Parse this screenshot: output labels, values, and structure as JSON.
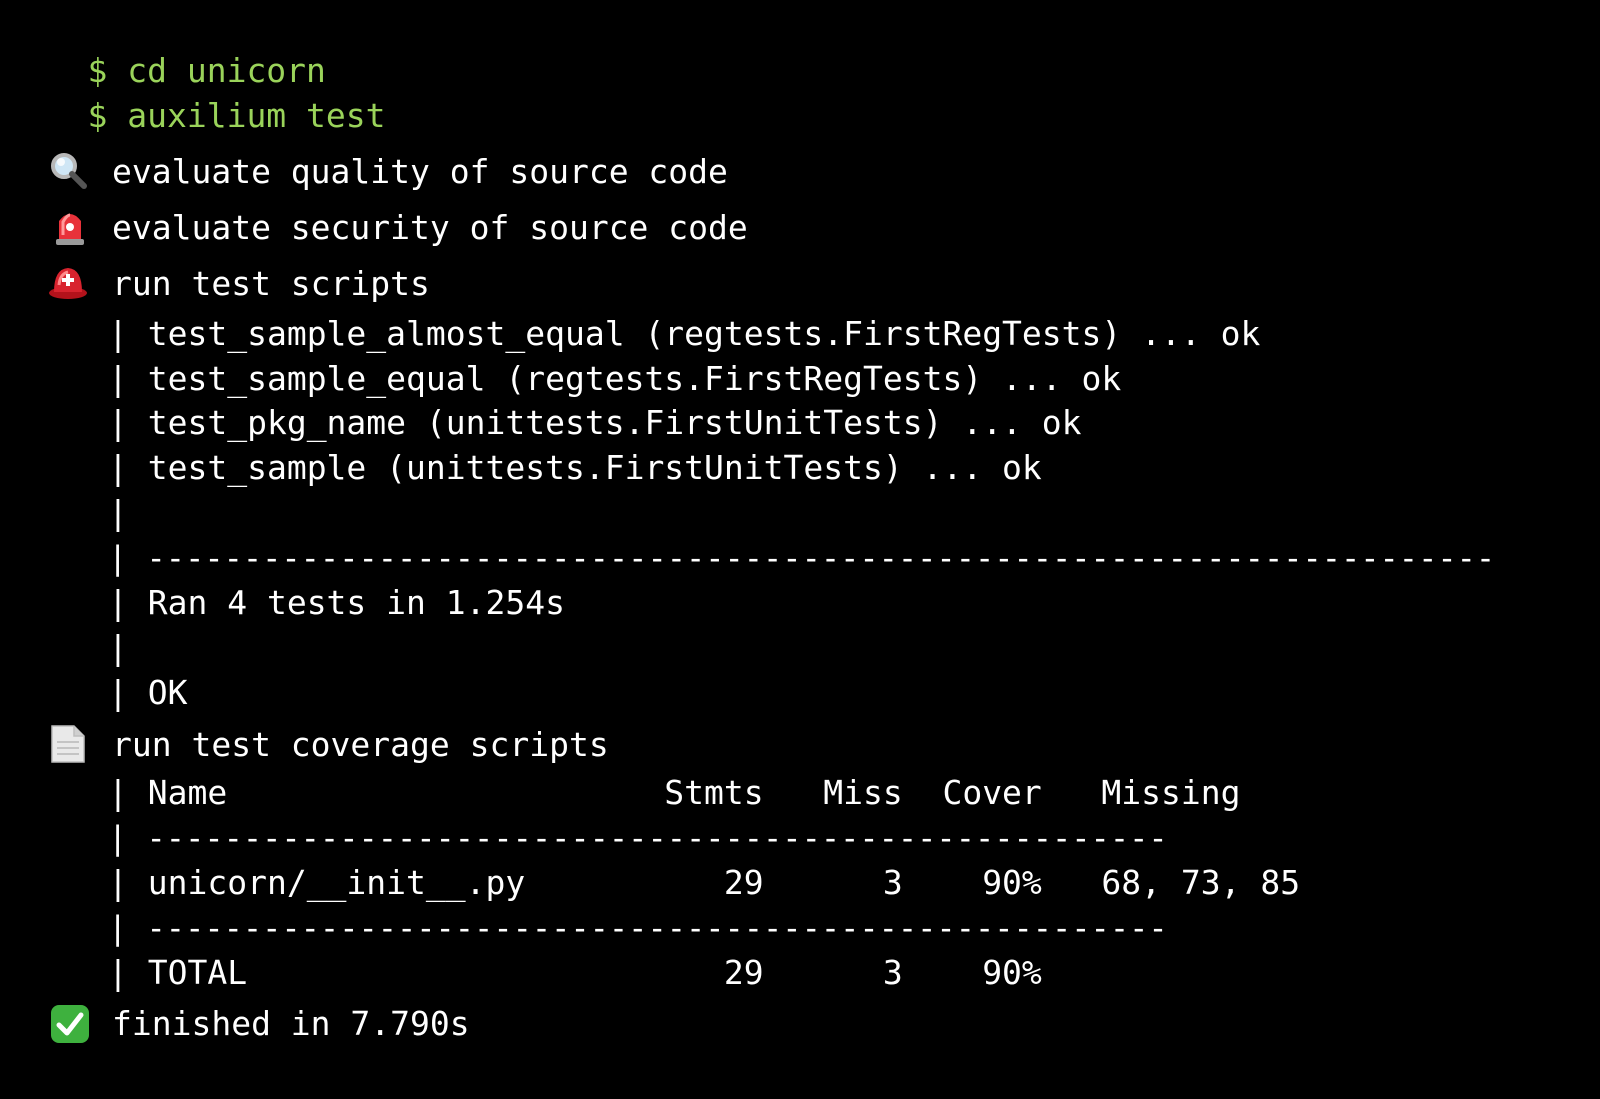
{
  "colors": {
    "background": "#000000",
    "prompt": "#9ad35a",
    "text": "#ffffff"
  },
  "commands": [
    {
      "prompt": "$",
      "text": "cd unicorn"
    },
    {
      "prompt": "$",
      "text": "auxilium test"
    }
  ],
  "steps": {
    "quality": {
      "icon": "magnifier-icon",
      "label": "evaluate quality of source code"
    },
    "security": {
      "icon": "siren-icon",
      "label": "evaluate security of source code"
    },
    "tests": {
      "icon": "helmet-icon",
      "label": "run test scripts"
    },
    "coverage": {
      "icon": "document-icon",
      "label": "run test coverage scripts"
    },
    "finished": {
      "icon": "check-icon",
      "label": "finished in 7.790s"
    }
  },
  "test_output": {
    "pipe": "|",
    "results": [
      "test_sample_almost_equal (regtests.FirstRegTests) ... ok",
      "test_sample_equal (regtests.FirstRegTests) ... ok",
      "test_pkg_name (unittests.FirstUnitTests) ... ok",
      "test_sample (unittests.FirstUnitTests) ... ok"
    ],
    "separator": "----------------------------------------------------------------------",
    "ran": "Ran 4 tests in 1.254s",
    "status": "OK"
  },
  "coverage_output": {
    "header": "Name                      Stmts   Miss  Cover   Missing",
    "separator": "-----------------------------------------------------",
    "rows": [
      "unicorn/__init__.py          29      3    90%   68, 73, 85"
    ],
    "total": "TOTAL                        29      3    90%"
  }
}
